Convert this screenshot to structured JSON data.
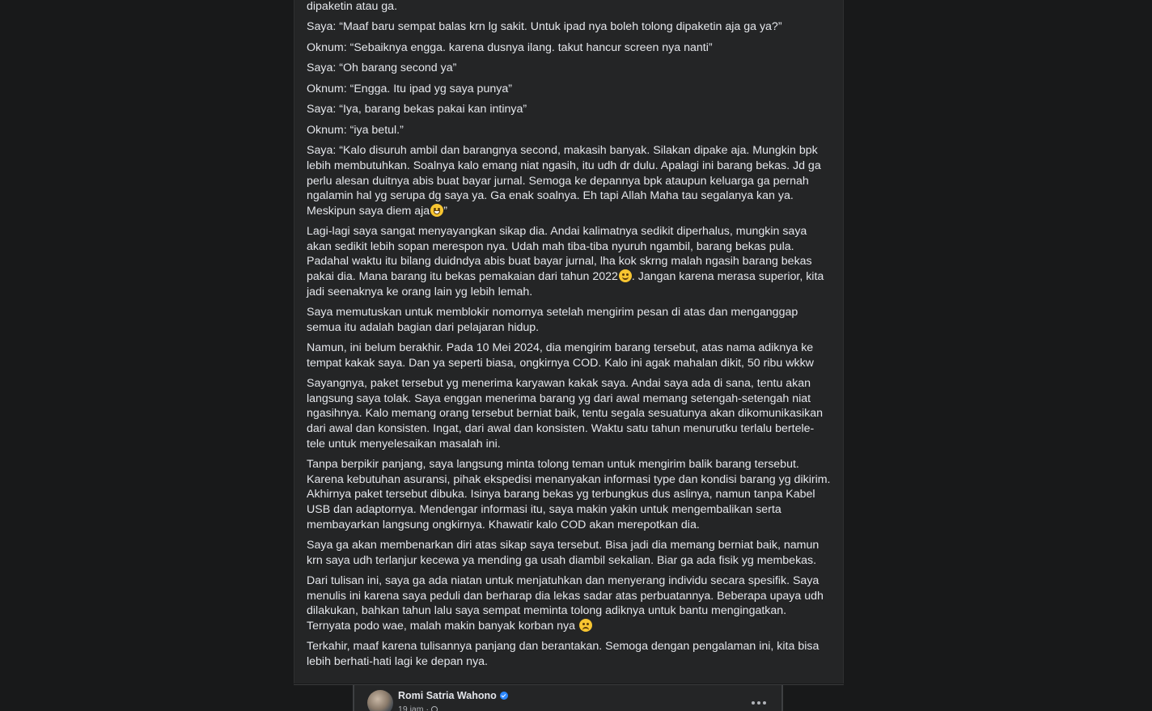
{
  "post": {
    "paragraphs": [
      {
        "text": "dipaketin atau ga."
      },
      {
        "text": "Saya: “Maaf baru sempat balas krn lg sakit. Untuk ipad nya boleh tolong dipaketin aja ga ya?”"
      },
      {
        "text": "Oknum: “Sebaiknya engga. karena dusnya ilang. takut hancur screen nya nanti”"
      },
      {
        "text": "Saya: “Oh barang second ya”"
      },
      {
        "text": "Oknum: “Engga. Itu ipad yg saya punya”"
      },
      {
        "text": "Saya: “Iya, barang bekas pakai kan intinya”"
      },
      {
        "text": "Oknum: “iya betul.”"
      },
      {
        "text": "Saya: “Kalo disuruh ambil dan barangnya second, makasih banyak. Silakan dipake aja. Mungkin bpk lebih membutuhkan. Soalnya kalo emang niat ngasih, itu udh dr dulu. Apalagi ini barang bekas. Jd ga perlu alesan duitnya abis buat bayar jurnal. Semoga ke depannya bpk ataupun keluarga ga pernah ngalamin hal yg serupa dg saya ya. Ga enak soalnya.  Eh tapi Allah Maha tau segalanya kan ya. Meskipun saya diem aja",
        "emoji": "grin-emoji",
        "after": "”"
      },
      {
        "text": "Lagi-lagi saya sangat menyayangkan sikap dia. Andai kalimatnya sedikit diperhalus, mungkin saya akan sedikit lebih sopan merespon nya. Udah mah tiba-tiba nyuruh ngambil, barang bekas pula. Padahal waktu itu bilang duidndya abis buat bayar jurnal, lha kok skrng malah ngasih barang bekas pakai dia. Mana barang itu bekas pemakaian dari tahun 2022",
        "emoji": "smile-emoji",
        "after": ". Jangan karena merasa superior, kita jadi seenaknya ke orang lain yg lebih lemah."
      },
      {
        "text": "Saya memutuskan untuk memblokir nomornya setelah mengirim pesan di atas dan menganggap semua itu adalah bagian dari pelajaran hidup."
      },
      {
        "text": "Namun, ini belum berakhir. Pada 10 Mei 2024, dia mengirim barang tersebut, atas nama adiknya ke tempat kakak saya. Dan ya seperti biasa, ongkirnya COD. Kalo ini agak mahalan dikit, 50 ribu wkkw"
      },
      {
        "text": "Sayangnya, paket tersebut yg menerima karyawan kakak saya. Andai saya ada di sana, tentu akan langsung saya tolak. Saya enggan menerima barang yg dari awal memang setengah-setengah niat ngasihnya. Kalo memang orang tersebut berniat baik, tentu segala sesuatunya akan dikomunikasikan dari awal dan konsisten. Ingat, dari awal dan konsisten. Waktu satu tahun menurutku terlalu bertele-tele untuk menyelesaikan masalah ini."
      },
      {
        "text": "Tanpa berpikir panjang, saya langsung minta tolong teman untuk mengirim balik barang tersebut. Karena kebutuhan asuransi, pihak ekspedisi menanyakan informasi type dan kondisi barang yg dikirim. Akhirnya paket tersebut dibuka. Isinya barang bekas yg terbungkus dus aslinya, namun tanpa Kabel USB dan adaptornya. Mendengar informasi itu, saya makin yakin untuk mengembalikan serta membayarkan langsung ongkirnya. Khawatir kalo COD akan merepotkan dia."
      },
      {
        "text": "Saya ga akan membenarkan diri atas sikap saya tersebut. Bisa jadi dia memang berniat baik, namun krn saya udh terlanjur kecewa ya mending ga usah diambil sekalian. Biar ga ada fisik yg membekas."
      },
      {
        "text": "Dari tulisan ini, saya ga ada niatan untuk menjatuhkan dan menyerang individu secara spesifik. Saya menulis ini karena saya peduli dan berharap dia lekas sadar atas perbuatannya. Beberapa upaya udh dilakukan, bahkan tahun lalu saya sempat meminta tolong adiknya untuk bantu mengingatkan. Ternyata podo wae, malah makin banyak korban nya ",
        "emoji": "sad-emoji",
        "after": ""
      },
      {
        "text": "Terkahir, maaf karena tulisannya panjang dan berantakan. Semoga dengan pengalaman ini, kita bisa lebih berhati-hati lagi ke depan nya."
      }
    ]
  },
  "embed": {
    "author": "Romi Satria Wahono",
    "time": "19 jam",
    "separator": "·",
    "verified_icon": "verified-badge-icon",
    "privacy_icon": "globe-icon",
    "more_icon": "more-options-icon"
  },
  "colors": {
    "background": "#18191a",
    "card": "#242526",
    "text": "#e4e6eb",
    "secondary_text": "#b0b3b8",
    "verified": "#2d88ff"
  }
}
